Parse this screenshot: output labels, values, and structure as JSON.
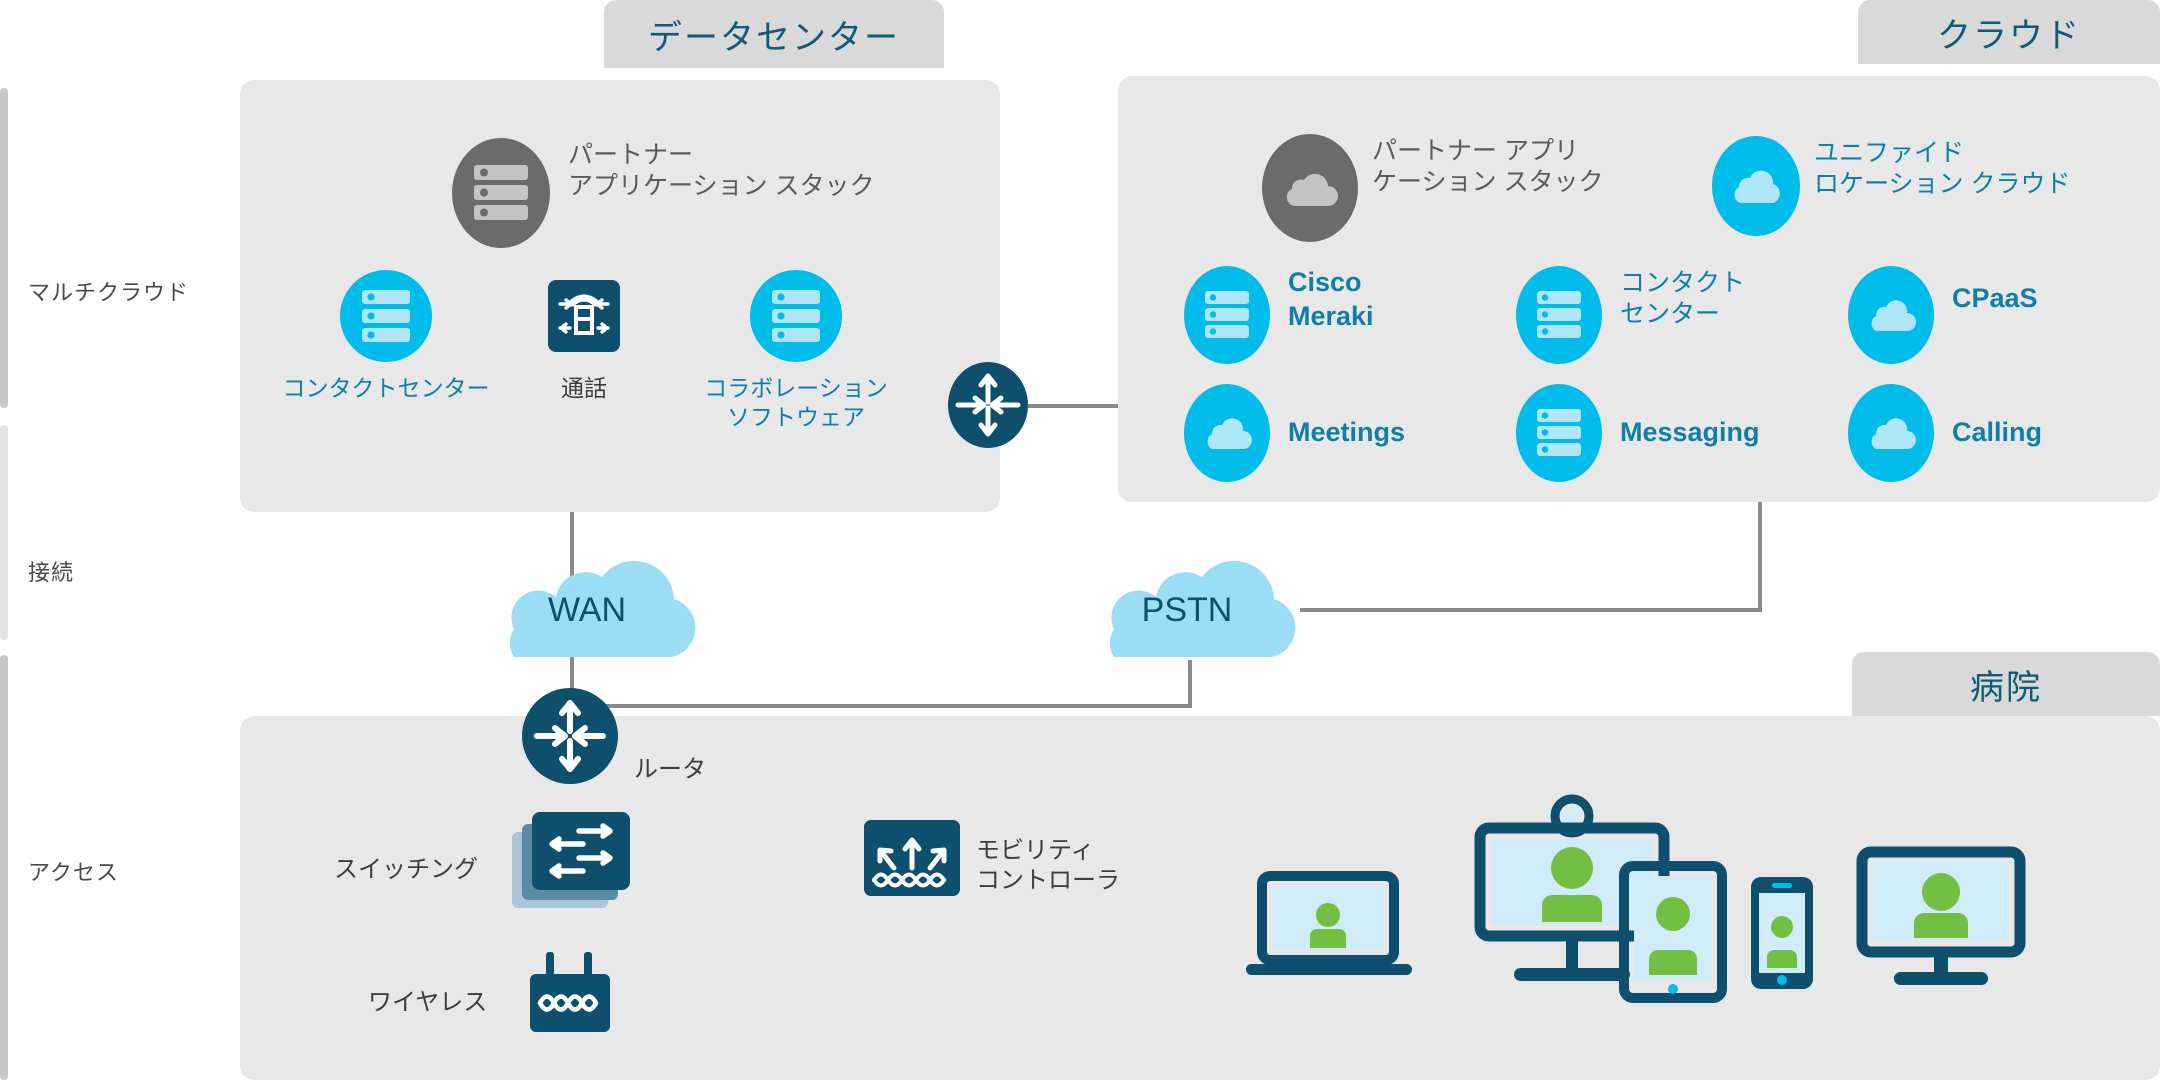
{
  "zones": [
    {
      "label": "マルチクラウド"
    },
    {
      "label": "接続"
    },
    {
      "label": "アクセス"
    }
  ],
  "tabs": {
    "datacenter": "データセンター",
    "cloud": "クラウド",
    "hospital": "病院"
  },
  "datacenter": {
    "partner": {
      "label": "パートナー\nアプリケーション スタック",
      "icon": "server-icon"
    },
    "items": [
      {
        "label": "コンタクトセンター",
        "icon": "server-icon",
        "style": "cyan-badge"
      },
      {
        "label": "通話",
        "icon": "voice-gateway-icon",
        "style": "dark-tile"
      },
      {
        "label": "コラボレーション\nソフトウェア",
        "icon": "server-icon",
        "style": "cyan-badge"
      }
    ]
  },
  "cloud": {
    "partner": {
      "label": "パートナー アプリ\nケーション スタック",
      "icon": "cloud-icon"
    },
    "unified": {
      "label": "ユニファイド\nロケーション クラウド",
      "icon": "cloud-icon"
    },
    "services": [
      {
        "label": "Cisco\nMeraki",
        "icon": "server-icon"
      },
      {
        "label": "コンタクト\nセンター",
        "icon": "server-icon"
      },
      {
        "label": "CPaaS",
        "icon": "cloud-icon"
      },
      {
        "label": "Meetings",
        "icon": "cloud-icon"
      },
      {
        "label": "Messaging",
        "icon": "server-icon"
      },
      {
        "label": "Calling",
        "icon": "cloud-icon"
      }
    ]
  },
  "connectivity": {
    "wan": "WAN",
    "pstn": "PSTN"
  },
  "access": {
    "router": {
      "label": "ルータ",
      "icon": "router-icon"
    },
    "switching": {
      "label": "スイッチング",
      "icon": "switch-icon"
    },
    "wireless": {
      "label": "ワイヤレス",
      "icon": "access-point-icon"
    },
    "mobility": {
      "label": "モビリティ\nコントローラ",
      "icon": "wireless-controller-icon"
    },
    "endpoints": [
      {
        "name": "laptop-endpoint"
      },
      {
        "name": "video-endpoint"
      },
      {
        "name": "tablet-endpoint"
      },
      {
        "name": "smartphone-endpoint"
      },
      {
        "name": "desktop-monitor-endpoint"
      }
    ]
  },
  "colors": {
    "cisco_cyan": "#00BCEB",
    "cisco_dark_blue": "#0d4f6c",
    "sky_cloud": "#9BDDF5",
    "panel_gray": "#e8e8e8",
    "tab_gray": "#d9d9d9",
    "line_gray": "#8a8a8a",
    "person_green": "#72BF44",
    "screen_fill": "#CFECF8"
  }
}
